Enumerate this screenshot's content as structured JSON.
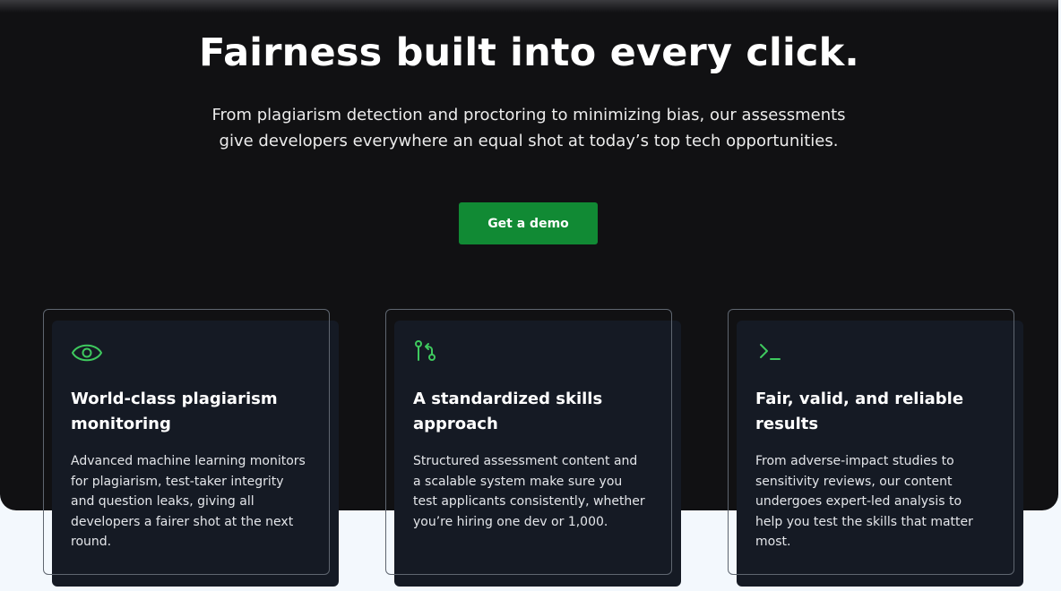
{
  "hero": {
    "title": "Fairness built into every click.",
    "subtitle": "From plagiarism detection and proctoring to minimizing bias, our assessments give developers everywhere an equal shot at today’s top tech opportunities.",
    "cta_label": "Get a demo"
  },
  "cards": [
    {
      "icon": "eye-icon",
      "title": "World-class plagiarism monitoring",
      "body": "Advanced machine learning monitors for plagiarism, test-taker integrity and question leaks, giving all developers a fairer shot at the next round."
    },
    {
      "icon": "git-pull-request-icon",
      "title": "A standardized skills approach",
      "body": "Structured assessment content and a scalable system make sure you test applicants consistently, whether you’re hiring one dev or 1,000."
    },
    {
      "icon": "terminal-icon",
      "title": "Fair, valid, and reliable results",
      "body": "From adverse-impact studies to sensitivity reviews, our content undergoes expert-led analysis to help you test the skills that matter most."
    }
  ],
  "colors": {
    "hero_background": "#111113",
    "cta_green": "#118a34",
    "icon_green": "#3ec95e",
    "card_background": "#151a24",
    "page_background": "#f3f8fd"
  }
}
